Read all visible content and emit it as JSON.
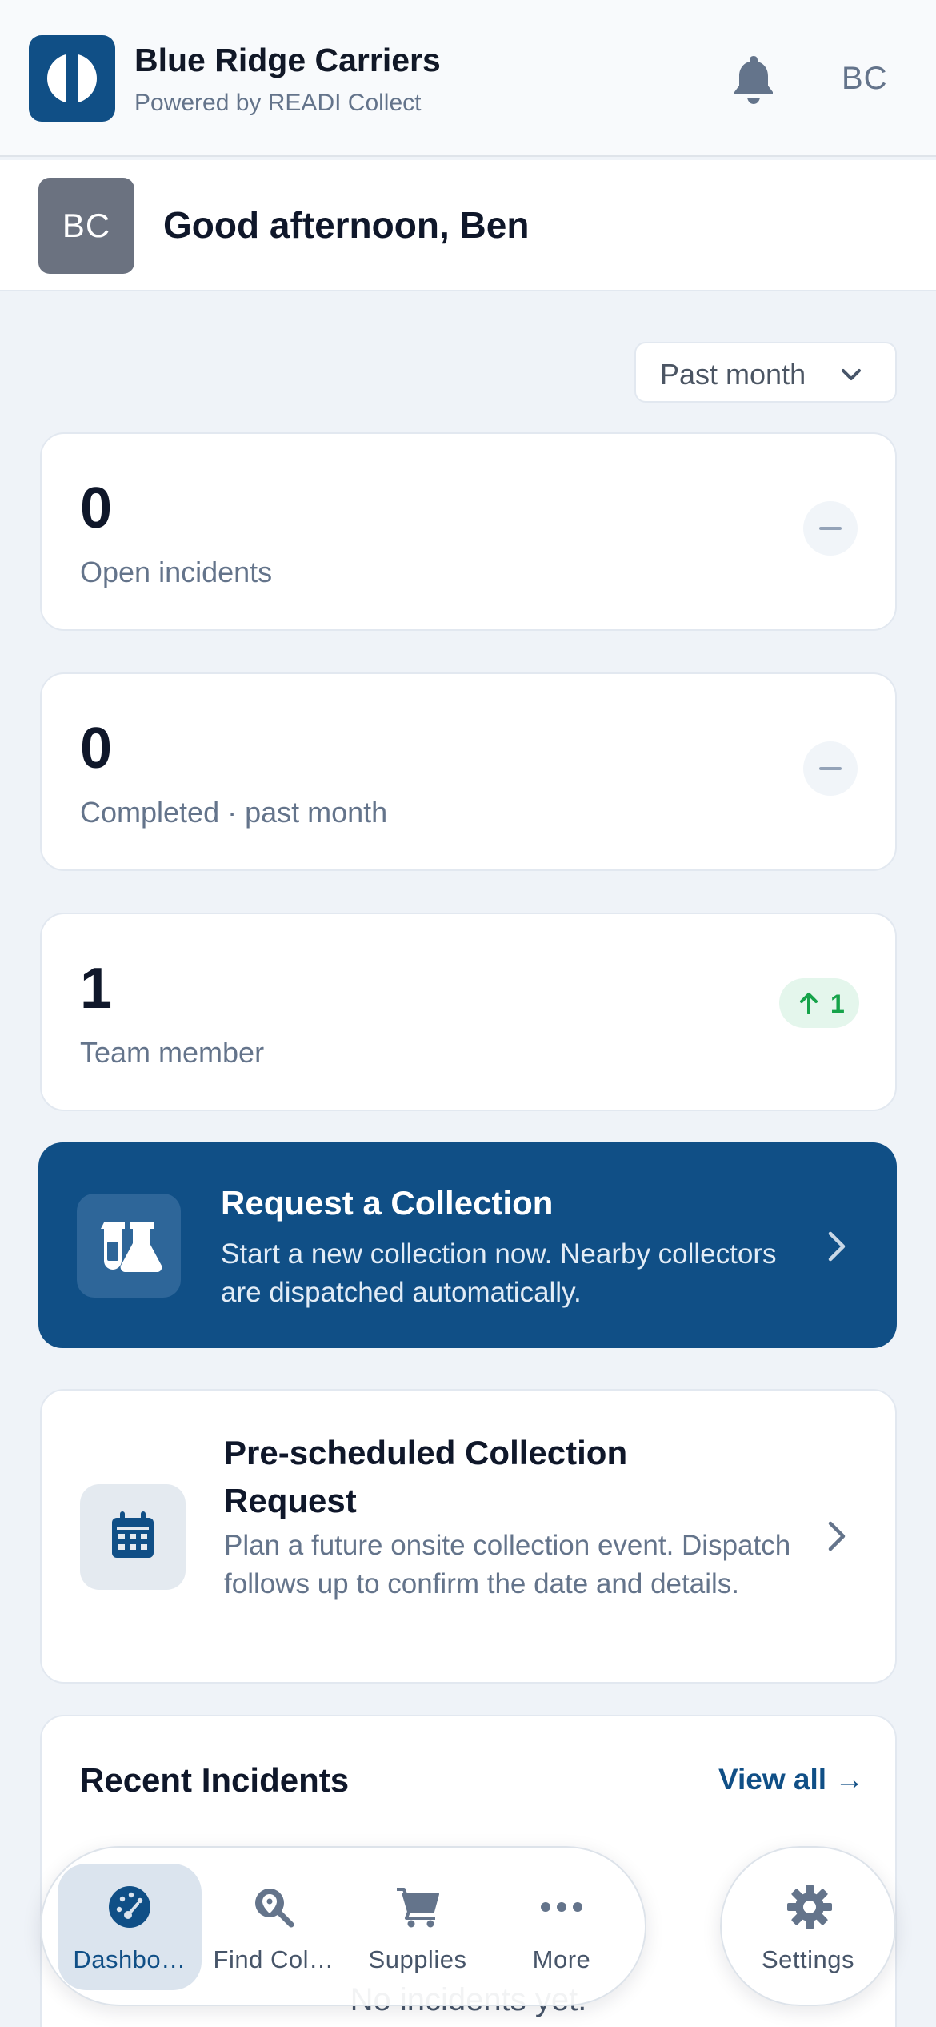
{
  "header": {
    "company_name": "Blue Ridge Carriers",
    "powered_by": "Powered by READI Collect",
    "user_initials": "BC"
  },
  "greeting": {
    "avatar_initials": "BC",
    "text": "Good afternoon, Ben"
  },
  "period_filter": {
    "selected": "Past month"
  },
  "stats": [
    {
      "value": "0",
      "label": "Open incidents",
      "trend": null
    },
    {
      "value": "0",
      "label": "Completed · past month",
      "trend": null
    },
    {
      "value": "1",
      "label": "Team member",
      "trend": "1"
    }
  ],
  "actions": {
    "request": {
      "title": "Request a Collection",
      "description": "Start a new collection now. Nearby collectors are dispatched automatically."
    },
    "prescheduled": {
      "title": "Pre-scheduled Collection Request",
      "description": "Plan a future onsite collection event. Dispatch follows up to confirm the date and details."
    }
  },
  "recent_incidents": {
    "title": "Recent Incidents",
    "view_all": "View all →",
    "empty_text": "No incidents yet."
  },
  "bottom_nav": {
    "items": [
      {
        "label": "Dashbo…",
        "icon": "dashboard-gauge-icon",
        "active": true
      },
      {
        "label": "Find Col…",
        "icon": "search-location-icon",
        "active": false
      },
      {
        "label": "Supplies",
        "icon": "cart-icon",
        "active": false
      },
      {
        "label": "More",
        "icon": "more-dots-icon",
        "active": false
      }
    ],
    "settings_label": "Settings"
  },
  "colors": {
    "brand": "#104f86",
    "background": "#eff3f8",
    "trend_green": "#16a34a"
  }
}
